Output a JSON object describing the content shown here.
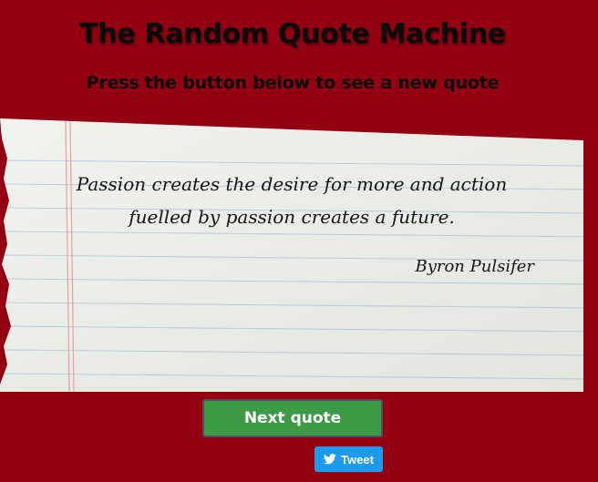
{
  "header": {
    "title": "The Random Quote Machine",
    "subtitle": "Press the button below to see a new quote"
  },
  "quote": {
    "text": "Passion creates the desire for more and action fuelled by passion creates a future.",
    "author": "Byron Pulsifer"
  },
  "actions": {
    "next_label": "Next quote",
    "tweet_label": "Tweet",
    "tweet_icon": "twitter-bird-icon"
  },
  "colors": {
    "background": "#920012",
    "next_button": "#3d9a45",
    "tweet_button": "#1d9bf0",
    "paper": "#eceeea",
    "rule_lines": "#b8c8e0",
    "margin_line": "#e8a0a0"
  }
}
